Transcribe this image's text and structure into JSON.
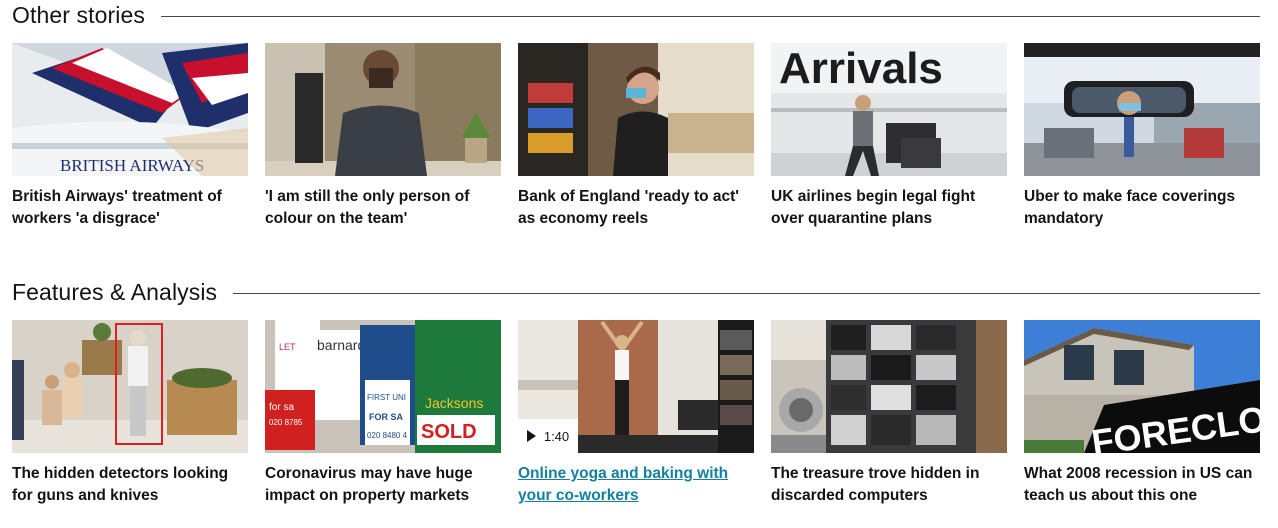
{
  "sections": [
    {
      "title": "Other stories",
      "cards": [
        {
          "headline": "British Airways' treatment of workers 'a disgrace'",
          "image_text": "BRITISH AIRWAYS"
        },
        {
          "headline": "'I am still the only person of colour on the team'"
        },
        {
          "headline": "Bank of England 'ready to act' as economy reels"
        },
        {
          "headline": "UK airlines begin legal fight over quarantine plans",
          "image_text": "Arrivals"
        },
        {
          "headline": "Uber to make face coverings mandatory"
        }
      ]
    },
    {
      "title": "Features & Analysis",
      "cards": [
        {
          "headline": "The hidden detectors looking for guns and knives"
        },
        {
          "headline": "Coronavirus may have huge impact on property markets",
          "signs": [
            "barnard marcus",
            "FIRST UNI",
            "FOR SA",
            "020 8480 4",
            "SOLD",
            "Jacksons",
            "LET",
            "for sa",
            "020 8785"
          ]
        },
        {
          "headline": "Online yoga and baking with your co-workers",
          "duration": "1:40"
        },
        {
          "headline": "The treasure trove hidden in discarded computers"
        },
        {
          "headline": "What 2008 recession in US can teach us about this one",
          "image_text": "FORECLOSURE"
        }
      ]
    }
  ]
}
